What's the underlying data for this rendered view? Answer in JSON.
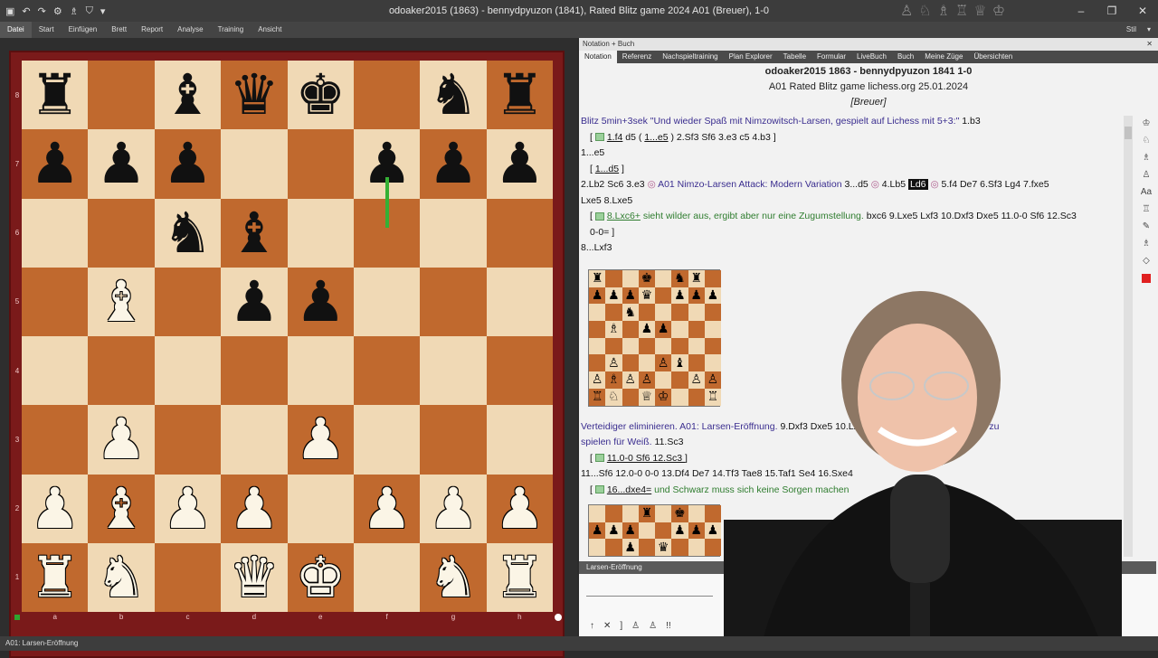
{
  "window": {
    "title": "odoaker2015 (1863) - bennydpyuzon (1841), Rated Blitz game 2024  A01  (Breuer), 1-0",
    "quick_access": [
      "▣",
      "↶",
      "↷",
      "⚙",
      "♗",
      "⛉",
      "▾"
    ],
    "title_pieces": [
      "♙",
      "♘",
      "♗",
      "♖",
      "♕",
      "♔"
    ],
    "controls": [
      "–",
      "❐",
      "✕"
    ]
  },
  "menu": {
    "items": [
      "Datei",
      "Start",
      "Einfügen",
      "Brett",
      "Report",
      "Analyse",
      "Training",
      "Ansicht"
    ],
    "style_label": "Stil",
    "style_arrow": "▾"
  },
  "board": {
    "ranks": [
      "8",
      "7",
      "6",
      "5",
      "4",
      "3",
      "2",
      "1"
    ],
    "files": [
      "a",
      "b",
      "c",
      "d",
      "e",
      "f",
      "g",
      "h"
    ],
    "position": [
      [
        "bR",
        "",
        "bB",
        "bQ",
        "bK",
        "",
        "bN",
        "bR"
      ],
      [
        "bP",
        "bP",
        "bP",
        "",
        "",
        "bP",
        "bP",
        "bP"
      ],
      [
        "",
        "",
        "bN",
        "bB",
        "",
        "",
        "",
        ""
      ],
      [
        "",
        "wB",
        "",
        "bP",
        "bP",
        "",
        "",
        ""
      ],
      [
        "",
        "",
        "",
        "",
        "",
        "",
        "",
        ""
      ],
      [
        "",
        "wP",
        "",
        "",
        "wP",
        "",
        "",
        ""
      ],
      [
        "wP",
        "wB",
        "wP",
        "wP",
        "",
        "wP",
        "wP",
        "wP"
      ],
      [
        "wR",
        "wN",
        "",
        "wQ",
        "wK",
        "",
        "wN",
        "wR"
      ]
    ],
    "light_color": "#f0d9b5",
    "dark_color": "#c0692e",
    "frame_color": "#7a1a1a",
    "arrow_color": "#35b035"
  },
  "panel": {
    "title": "Notation + Buch",
    "close": "✕",
    "tabs": [
      "Notation",
      "Referenz",
      "Nachspieltraining",
      "Plan Explorer",
      "Tabelle",
      "Formular",
      "LiveBuch",
      "Buch",
      "Meine Züge",
      "Übersichten"
    ],
    "header": {
      "line1": "odoaker2015  1863  -  bennydpyuzon  1841  1-0",
      "line2": "A01  Rated Blitz game lichess.org  25.01.2024",
      "line3": "[Breuer]"
    }
  },
  "notation": {
    "p1_blue": "Blitz 5min+3sek \"Und wieder Spaß mit Nimzowitsch-Larsen, gespielt auf Lichess mit 5+3:\"",
    "p1_move": "1.b3",
    "v1_a": "1.f4",
    "v1_b": "d5  (",
    "v1_c": "1...e5",
    "v1_d": ")  2.Sf3  Sf6  3.e3  c5  4.b3 ]",
    "m2": "1...e5",
    "v2": "1...d5",
    "m3a": "2.Lb2  Sc6  3.e3",
    "m3b": "A01 Nimzo-Larsen Attack: Modern Variation",
    "m3c": "3...d5",
    "m3d": "4.Lb5",
    "m3e": "Ld6",
    "m3f": "5.f4  De7  6.Sf3  Lg4  7.fxe5",
    "m4": "Lxe5  8.Lxe5",
    "v3_a": "8.Lxc6+",
    "v3_b": "sieht wilder aus, ergibt aber nur eine Zugumstellung.",
    "v3_c": "bxc6  9.Lxe5  Lxf3  10.Dxf3  Dxe5  11.0-0  Sf6  12.Sc3",
    "v3_d": "0-0= ]",
    "m5": "8...Lxf3",
    "c6_blue": "Verteidiger eliminieren. A01: Larsen-Eröffnung.",
    "c6_moves": "9.Dxf3  Dxe5  10.Lxc6+",
    "c6_blue2": "Engine, aber angenehmer zu",
    "c7_blue": "spielen für Weiß.",
    "c7_move": "11.Sc3",
    "v4": "11.0-0  Sf6  12.Sc3 ]",
    "m8": "11...Sf6  12.0-0  0-0  13.Df4  De7  14.Tf3  Tae8  15.Taf1  Se4  16.Sxe4",
    "v5_a": "16...dxe4=",
    "v5_b": "und Schwarz muss sich keine Sorgen machen"
  },
  "mini_board": [
    [
      "♜",
      "",
      "",
      "♚",
      "",
      "♞",
      "♜",
      ""
    ],
    [
      "♟",
      "♟",
      "♟",
      "♛",
      "",
      "♟",
      "♟",
      "♟"
    ],
    [
      "",
      "",
      "♞",
      "",
      "",
      "",
      "",
      ""
    ],
    [
      "",
      "♗",
      "",
      "♟",
      "♟",
      "",
      "",
      ""
    ],
    [
      "",
      "",
      "",
      "",
      "",
      "",
      "",
      ""
    ],
    [
      "",
      "♙",
      "",
      "",
      "♙",
      "♝",
      "",
      ""
    ],
    [
      "♙",
      "♗",
      "♙",
      "♙",
      "",
      "",
      "♙",
      "♙"
    ],
    [
      "♖",
      "♘",
      "",
      "♕",
      "♔",
      "",
      "",
      "♖"
    ]
  ],
  "mini_board2_top": [
    [
      "",
      "",
      "",
      "♜",
      "",
      "♚",
      "",
      ""
    ],
    [
      "♟",
      "♟",
      "♟",
      "",
      "",
      "♟",
      "♟",
      "♟"
    ],
    [
      "",
      "",
      "♟",
      "",
      "♛",
      "",
      "",
      ""
    ]
  ],
  "opening_bar": "Larsen-Eröffnung",
  "toolstrip_icons": [
    "♔",
    "♘",
    "♗",
    "♙",
    "Aa",
    "♖",
    "✎",
    "♗",
    "◇"
  ],
  "timeline_controls": [
    "↑",
    "✕",
    "]",
    "♙",
    "♙",
    "!!"
  ],
  "status": "A01: Larsen-Eröffnung"
}
